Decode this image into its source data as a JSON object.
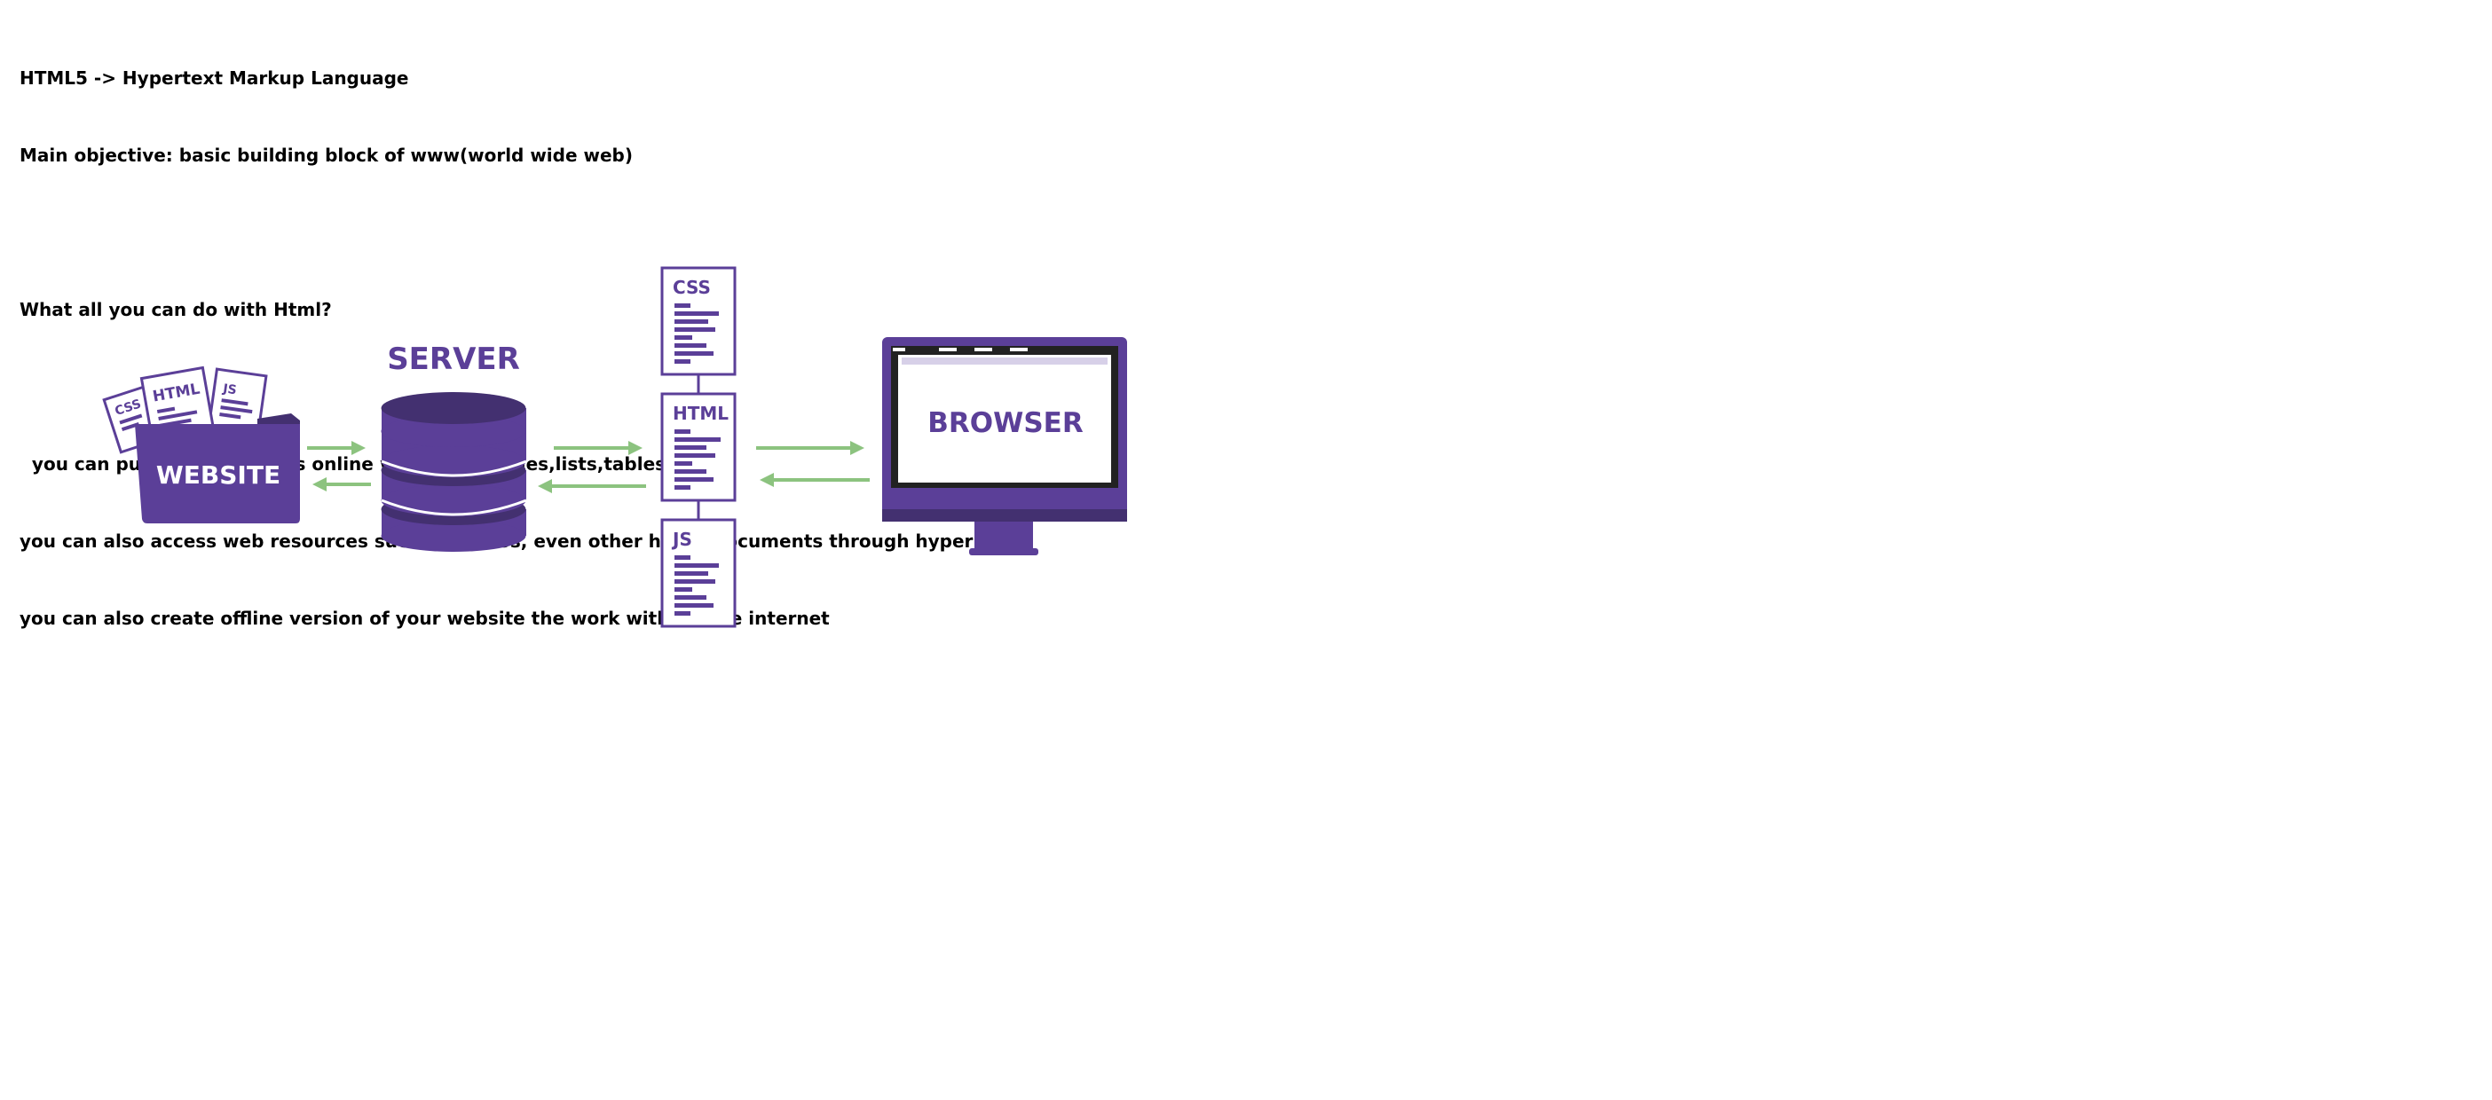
{
  "notes": {
    "line1": "HTML5 -> Hypertext Markup Language",
    "line2": "Main objective: basic building block of www(world wide web)",
    "line3": "What all you can do with Html?",
    "line4": "  you can publish documents online with text,images,lists,tables etc",
    "line5": "you can also access web resources such as videos, even other html5 documents through hyperlinks",
    "line6": "you can also create offline version of your website the work without the internet"
  },
  "diagram": {
    "colors": {
      "purple": "#5b3f98",
      "purple_dark": "#433070",
      "arrow_green": "#8cc37f",
      "screen_bar": "#d7d0e8"
    },
    "website": {
      "label": "WEBSITE",
      "doc_labels": [
        "CSS",
        "HTML",
        "JS"
      ]
    },
    "server": {
      "label": "SERVER"
    },
    "files": {
      "css": "CSS",
      "html": "HTML",
      "js": "JS"
    },
    "browser": {
      "label": "BROWSER"
    }
  }
}
